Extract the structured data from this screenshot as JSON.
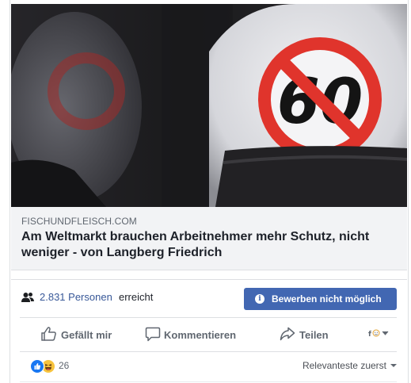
{
  "hero_image": {
    "sign_number": "60"
  },
  "link_preview": {
    "domain": "FISCHUNDFLEISCH.COM",
    "headline": "Am Weltmarkt brauchen Arbeitnehmer mehr Schutz, nicht weniger - von Langberg Friedrich"
  },
  "reach": {
    "icon": "people-icon",
    "count": "2.831 Personen",
    "label": "erreicht"
  },
  "boost_button": {
    "label": "Bewerben nicht möglich",
    "icon": "info-icon",
    "color": "#4267b2"
  },
  "actions": {
    "like": "Gefällt mir",
    "comment": "Kommentieren",
    "share": "Teilen",
    "reaction_selector_icon": "emoji-icon"
  },
  "reactions": {
    "count": "26",
    "types": [
      "like",
      "haha"
    ]
  },
  "comments_sort": {
    "label": "Relevanteste zuerst"
  }
}
